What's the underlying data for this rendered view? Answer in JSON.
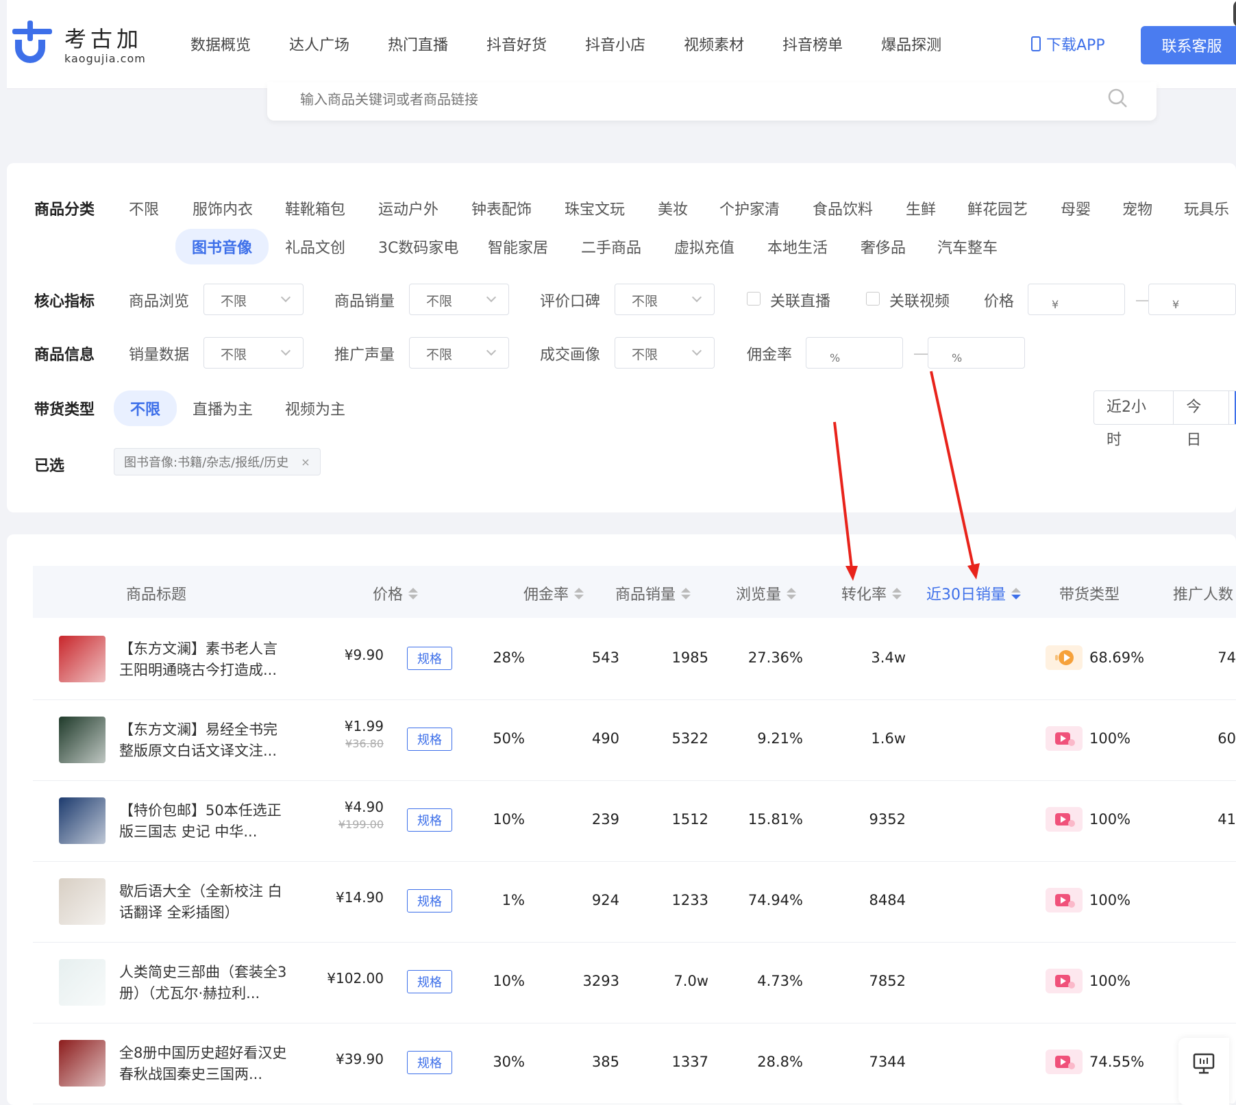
{
  "header": {
    "brand_name": "考古加",
    "brand_domain": "kaogujia.com",
    "nav": [
      "数据概览",
      "达人广场",
      "热门直播",
      "抖音好货",
      "抖音小店",
      "视频素材",
      "抖音榜单",
      "爆品探测"
    ],
    "active_nav_index": 3,
    "download_label": "下载APP",
    "contact_label": "联系客服",
    "accent_color": "#3d6fe9"
  },
  "search": {
    "placeholder": "输入商品关键词或者商品链接"
  },
  "filters": {
    "category_label": "商品分类",
    "categories_row1": [
      "不限",
      "服饰内衣",
      "鞋靴箱包",
      "运动户外",
      "钟表配饰",
      "珠宝文玩",
      "美妆",
      "个护家清",
      "食品饮料",
      "生鲜",
      "鲜花园艺",
      "母婴",
      "宠物",
      "玩具乐"
    ],
    "categories_row2": [
      "图书音像",
      "礼品文创",
      "3C数码家电",
      "智能家居",
      "二手商品",
      "虚拟充值",
      "本地生活",
      "奢侈品",
      "汽车整车"
    ],
    "active_category": "图书音像",
    "core_label": "核心指标",
    "core": {
      "browse_label": "商品浏览",
      "browse_value": "不限",
      "sales_label": "商品销量",
      "sales_value": "不限",
      "rating_label": "评价口碑",
      "rating_value": "不限",
      "live_label": "关联直播",
      "video_label": "关联视频",
      "price_label": "价格",
      "price_min_placeholder": "¥",
      "price_max_placeholder": "¥"
    },
    "info_label": "商品信息",
    "info": {
      "salesdata_label": "销量数据",
      "salesdata_value": "不限",
      "promo_label": "推广声量",
      "promo_value": "不限",
      "portrait_label": "成交画像",
      "portrait_value": "不限",
      "commission_label": "佣金率",
      "commission_min_placeholder": "%",
      "commission_max_placeholder": "%"
    },
    "type_label": "带货类型",
    "types": [
      "不限",
      "直播为主",
      "视频为主"
    ],
    "active_type": "不限",
    "time_ranges": [
      "近2小时",
      "今日"
    ],
    "selected_label": "已选",
    "selected_tag": "图书音像:书籍/杂志/报纸/历史",
    "selected_tag_close": "×"
  },
  "table": {
    "columns": {
      "title": "商品标题",
      "price": "价格",
      "commission": "佣金率",
      "sales": "商品销量",
      "views": "浏览量",
      "conversion": "转化率",
      "sales30": "近30日销量",
      "type": "带货类型",
      "promoters": "推广人数"
    },
    "active_sort_column": "近30日销量",
    "spec_label": "规格",
    "rows": [
      {
        "title": "【东方文澜】素书老人言王阳明通晓古今打造成...",
        "price": "¥9.90",
        "old_price": "",
        "commission": "28%",
        "sales": "543",
        "views": "1985",
        "conversion": "27.36%",
        "sales30": "3.4w",
        "type_icon": "live-icon",
        "type_pct": "68.69%",
        "promoters": "74"
      },
      {
        "title": "【东方文澜】易经全书完整版原文白话文译文注...",
        "price": "¥1.99",
        "old_price": "¥36.80",
        "commission": "50%",
        "sales": "490",
        "views": "5322",
        "conversion": "9.21%",
        "sales30": "1.6w",
        "type_icon": "video-icon",
        "type_pct": "100%",
        "promoters": "60"
      },
      {
        "title": "【特价包邮】50本任选正版三国志 史记 中华...",
        "price": "¥4.90",
        "old_price": "¥199.00",
        "commission": "10%",
        "sales": "239",
        "views": "1512",
        "conversion": "15.81%",
        "sales30": "9352",
        "type_icon": "video-icon",
        "type_pct": "100%",
        "promoters": "41"
      },
      {
        "title": "歇后语大全（全新校注 白话翻译 全彩插图）",
        "price": "¥14.90",
        "old_price": "",
        "commission": "1%",
        "sales": "924",
        "views": "1233",
        "conversion": "74.94%",
        "sales30": "8484",
        "type_icon": "video-icon",
        "type_pct": "100%",
        "promoters": ""
      },
      {
        "title": "人类简史三部曲（套装全3册）（尤瓦尔·赫拉利...",
        "price": "¥102.00",
        "old_price": "",
        "commission": "10%",
        "sales": "3293",
        "views": "7.0w",
        "conversion": "4.73%",
        "sales30": "7852",
        "type_icon": "video-icon",
        "type_pct": "100%",
        "promoters": ""
      },
      {
        "title": "全8册中国历史超好看汉史春秋战国秦史三国两...",
        "price": "¥39.90",
        "old_price": "",
        "commission": "30%",
        "sales": "385",
        "views": "1337",
        "conversion": "28.8%",
        "sales30": "7344",
        "type_icon": "video-icon",
        "type_pct": "74.55%",
        "promoters": ""
      }
    ],
    "thumb_colors": [
      "#c8262b",
      "#1f3a2a",
      "#1d3b6e",
      "#d8cfc4",
      "#e6efef",
      "#8c1c1c"
    ]
  },
  "annotation": {
    "arrow_color": "#e8231b"
  }
}
